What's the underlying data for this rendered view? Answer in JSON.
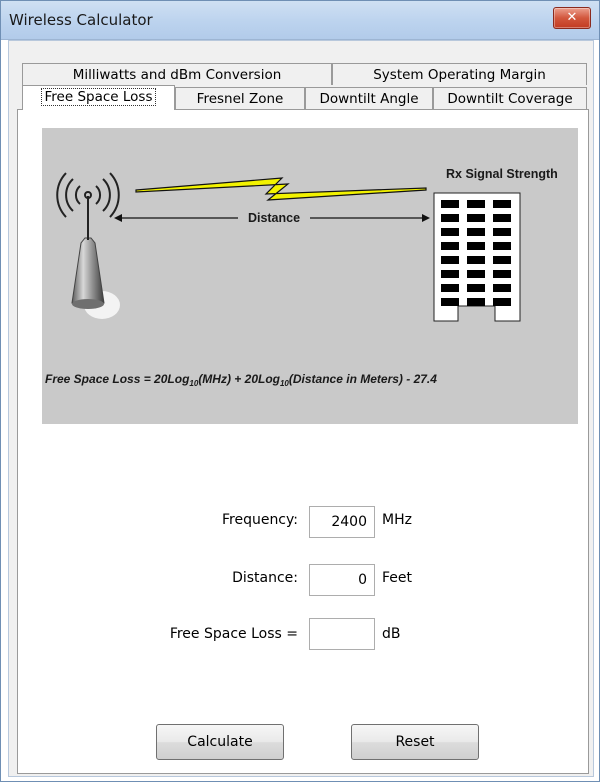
{
  "window": {
    "title": "Wireless Calculator",
    "close_label": "✕"
  },
  "tabs": {
    "row_back": [
      {
        "label": "Milliwatts and dBm Conversion"
      },
      {
        "label": "System Operating Margin"
      }
    ],
    "row_front": [
      {
        "label": "Free Space Loss",
        "active": true
      },
      {
        "label": "Fresnel Zone"
      },
      {
        "label": "Downtilt Angle"
      },
      {
        "label": "Downtilt Coverage"
      }
    ]
  },
  "diagram": {
    "rx_label": "Rx Signal Strength",
    "distance_label": "Distance",
    "formula_parts": [
      "Free Space Loss = 20Log",
      "10",
      "(MHz) + 20Log",
      "10",
      "(Distance in Meters) - 27.4"
    ],
    "colors": {
      "background": "#c9c9c9",
      "lightning": "#f2f200"
    }
  },
  "form": {
    "frequency": {
      "label": "Frequency:",
      "value": "2400",
      "unit": "MHz"
    },
    "distance": {
      "label": "Distance:",
      "value": "0",
      "unit": "Feet"
    },
    "result": {
      "label": "Free Space Loss =",
      "value": "",
      "unit": "dB"
    }
  },
  "buttons": {
    "calculate": "Calculate",
    "reset": "Reset"
  }
}
